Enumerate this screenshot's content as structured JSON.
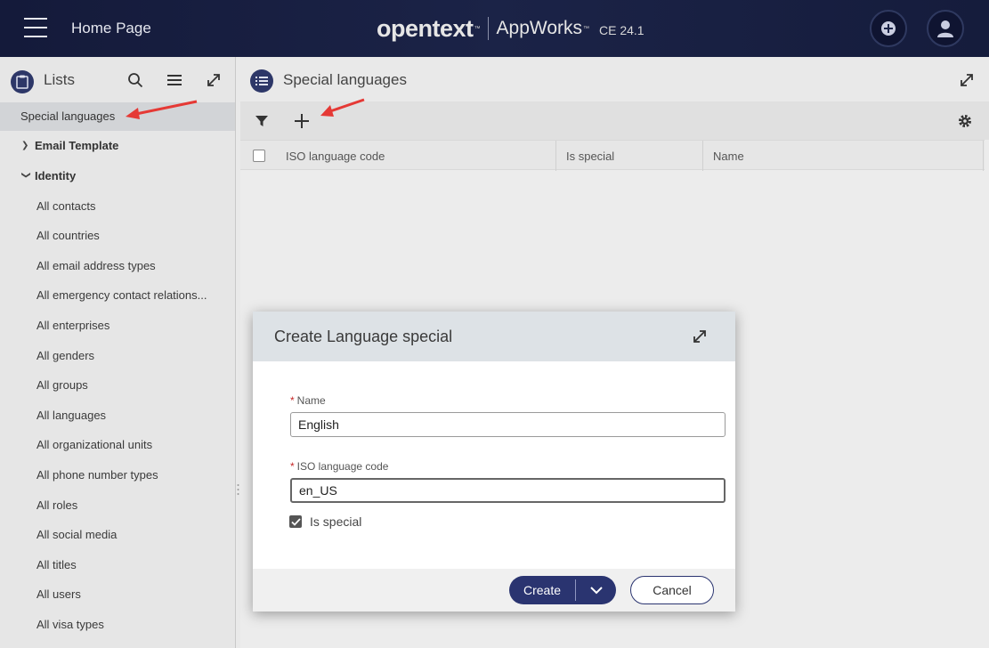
{
  "topbar": {
    "page_title": "Home Page",
    "brand_logo": "opentext",
    "brand_tm": "™",
    "brand_app": "AppWorks",
    "brand_app_tm": "™",
    "brand_edition": "CE  24.1"
  },
  "left_panel": {
    "title": "Lists",
    "selected_item": "Special languages",
    "groups": [
      {
        "label": "Email Template",
        "expanded": false
      },
      {
        "label": "Identity",
        "expanded": true
      }
    ],
    "identity_items": [
      "All contacts",
      "All countries",
      "All email address types",
      "All emergency contact relations...",
      "All enterprises",
      "All genders",
      "All groups",
      "All languages",
      "All organizational units",
      "All phone number types",
      "All roles",
      "All social media",
      "All titles",
      "All users",
      "All visa types"
    ]
  },
  "right_panel": {
    "title": "Special languages",
    "columns": [
      "ISO language code",
      "Is special",
      "Name"
    ]
  },
  "modal": {
    "title": "Create Language special",
    "name_label": "Name",
    "name_value": "English",
    "iso_label": "ISO language code",
    "iso_value": "en_US",
    "is_special_label": "Is special",
    "is_special_checked": true,
    "create_label": "Create",
    "cancel_label": "Cancel"
  },
  "colors": {
    "accent": "#2a3470",
    "topbar": "#1b2347",
    "annotation_arrow": "#e53935",
    "required": "#c62828"
  }
}
